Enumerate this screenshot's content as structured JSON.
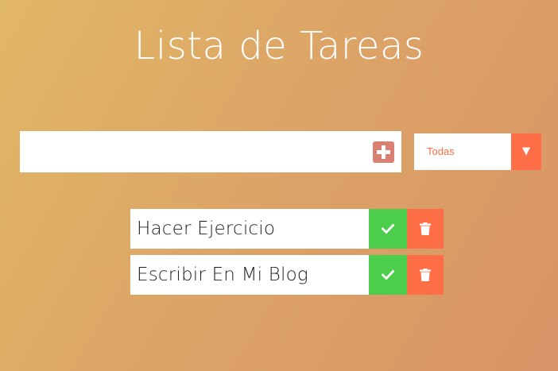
{
  "header": {
    "title": "Lista de Tareas"
  },
  "add_form": {
    "input_value": "",
    "input_placeholder": "",
    "add_icon": "plus-square-icon"
  },
  "filter": {
    "selected": "Todas",
    "arrow_glyph": "▼"
  },
  "todos": [
    {
      "text": "Hacer Ejercicio"
    },
    {
      "text": "Escribir En Mi Blog"
    }
  ],
  "colors": {
    "accent": "#ff6f47",
    "complete": "#4cce4c",
    "add_button": "#d98072",
    "background_start": "#e1b866",
    "background_end": "#d99467"
  }
}
